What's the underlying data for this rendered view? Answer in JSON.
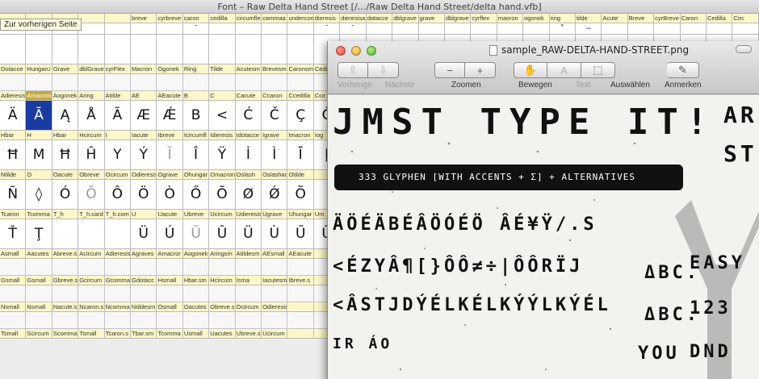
{
  "font_window": {
    "title": "Font – Raw Delta Hand Street [/…/Raw Delta Hand Street/delta hand.vfb]",
    "tooltip": "Zur vorherigen Seite",
    "rows": [
      {
        "kind": "name",
        "cells": [
          "",
          "",
          "",
          "",
          "",
          "breve",
          "cyrbreve",
          "caron",
          "cedilla",
          "circumfle",
          "commaa",
          "undercom",
          "dieresis",
          "dieresisa",
          "dotacce",
          "dblgrave",
          "grave",
          "dblgrave",
          "cyrflex",
          "macron",
          "ogonek",
          "ring",
          "tilde",
          "Acute",
          "Breve",
          "cyrBreve",
          "Caron",
          "Cedilla",
          "Circ"
        ]
      },
      {
        "kind": "glyph-short",
        "cells": [
          "",
          "",
          "",
          "",
          "",
          "",
          "",
          "˘",
          "",
          "",
          "",
          "",
          "¨",
          "¨",
          "",
          "",
          "",
          "",
          "",
          "",
          "",
          "˚",
          "~",
          "",
          "",
          "",
          "",
          "",
          ""
        ]
      },
      {
        "kind": "glyph-tall",
        "cells": [
          "",
          "",
          "",
          "",
          "",
          "",
          "",
          "",
          "",
          "",
          "",
          "",
          "",
          "",
          "",
          "",
          "",
          "",
          "",
          "",
          "",
          "",
          "",
          "",
          "",
          "",
          "",
          "",
          ""
        ]
      },
      {
        "kind": "name",
        "cells": [
          "Dotacce",
          "Hungaru",
          "Grave",
          "dblGrave",
          "cyrFlex",
          "Macron",
          "Ogonek",
          "Ring",
          "Tilde",
          "Acutesm",
          "Brevesm",
          "Caronsm",
          "Cedillas",
          "",
          "",
          "",
          "",
          "",
          "",
          "",
          "",
          "",
          "",
          "",
          "",
          "",
          "",
          "",
          ""
        ]
      },
      {
        "kind": "spacer",
        "cells": [
          "",
          "",
          "",
          "",
          "",
          "",
          "",
          "",
          "",
          "",
          "",
          "",
          "",
          "",
          "",
          "",
          "",
          "",
          "",
          "",
          "",
          "",
          "",
          "",
          "",
          "",
          "",
          "",
          ""
        ]
      },
      {
        "kind": "name",
        "cells": [
          "Adieresis",
          "Amacron",
          "Aogonek",
          "Aring",
          "Atilde",
          "AE",
          "AEacute",
          "B",
          "C",
          "Cacute",
          "Ccaron",
          "Ccedilla",
          "Ccir",
          "",
          "",
          "",
          "",
          "",
          "",
          "",
          "",
          "",
          "",
          "",
          "",
          "",
          "",
          "",
          ""
        ]
      },
      {
        "kind": "glyph-tall",
        "cells": [
          "Ä",
          "Ā",
          "Ą",
          "Å",
          "Ã",
          "Æ",
          "Ǽ",
          "B",
          "<",
          "Ć",
          "Č",
          "Ç",
          "Ĉ",
          "",
          "",
          "",
          "",
          "",
          "",
          "",
          "",
          "",
          "",
          "",
          "",
          "",
          "",
          "",
          ""
        ]
      },
      {
        "kind": "name",
        "cells": [
          "Hbar",
          "H",
          "Hbar",
          "Hcircum",
          "I",
          "Iacute",
          "Ibreve",
          "Icircumfl",
          "Idieresis",
          "Idotacce",
          "Igrave",
          "Imacron",
          "Iog",
          "",
          "",
          "",
          "",
          "",
          "",
          "",
          "",
          "",
          "",
          "",
          "",
          "",
          "",
          "",
          ""
        ]
      },
      {
        "kind": "glyph-tall",
        "cells": [
          "Ħ",
          "M",
          "Ħ",
          "Ĥ",
          "Y",
          "Ý",
          "Ĭ",
          "Î",
          "Ÿ",
          "İ",
          "Ì",
          "Ī",
          "Į",
          "",
          "",
          "",
          "",
          "",
          "",
          "",
          "",
          "",
          "",
          "",
          "",
          "",
          "",
          "",
          ""
        ]
      },
      {
        "kind": "name",
        "cells": [
          "Ntilde",
          "O",
          "Oacute",
          "Obreve",
          "Ocircum",
          "Odieresis",
          "Ograve",
          "Ohungar",
          "Omacron",
          "Oslash",
          "Oslashac",
          "Otilde",
          "",
          "",
          "",
          "",
          "",
          "",
          "",
          "",
          "",
          "",
          "",
          "",
          "",
          "",
          "",
          "",
          ""
        ]
      },
      {
        "kind": "glyph-tall",
        "cells": [
          "Ñ",
          "◊",
          "Ó",
          "Ŏ",
          "Ô",
          "Ö",
          "Ò",
          "Ő",
          "Ō",
          "Ø",
          "Ǿ",
          "Õ",
          "",
          "",
          "",
          "",
          "",
          "",
          "",
          "",
          "",
          "",
          "",
          "",
          "",
          "",
          "",
          "",
          ""
        ]
      },
      {
        "kind": "name",
        "cells": [
          "Tcaron",
          "Tcomma",
          "T_h",
          "T_h.card",
          "T_h.com",
          "U",
          "Uacute",
          "Ubreve",
          "Ucircum",
          "Udieresis",
          "Ugrave",
          "Uhungar",
          "Um",
          "",
          "",
          "",
          "",
          "",
          "",
          "",
          "",
          "",
          "",
          "",
          "",
          "",
          "",
          "",
          ""
        ]
      },
      {
        "kind": "glyph-tall",
        "cells": [
          "Ť",
          "Ţ",
          "",
          "",
          "",
          "Ü",
          "Ú",
          "Ŭ",
          "Û",
          "Ü",
          "Ù",
          "Ű",
          "Ū",
          "",
          "",
          "",
          "",
          "",
          "",
          "",
          "",
          "",
          "",
          "",
          "",
          "",
          "",
          "",
          ""
        ]
      },
      {
        "kind": "name",
        "cells": [
          "Asmall",
          "Aacutes",
          "Abreve.s",
          "Acircum",
          "Adieresis",
          "Agraves",
          "Amacror",
          "Aogonek",
          "Aringsm",
          "Atildesm",
          "AEsmall",
          "AEacute",
          "",
          "",
          "",
          "",
          "",
          "",
          "",
          "",
          "",
          "",
          "",
          "",
          "",
          "",
          "",
          "",
          ""
        ]
      },
      {
        "kind": "spacer",
        "cells": [
          "",
          "",
          "",
          "",
          "",
          "",
          "",
          "",
          "",
          "",
          "",
          "",
          "",
          "",
          "",
          "",
          "",
          "",
          "",
          "",
          "",
          "",
          "",
          "",
          "",
          "",
          "",
          "",
          ""
        ]
      },
      {
        "kind": "name",
        "cells": [
          "Gsmall",
          "Gsmall",
          "Gbreve.s",
          "Gcircum",
          "Gcomma",
          "Gdotacc",
          "Hsmall",
          "Hbar.sm",
          "Hcircum",
          "Isma",
          "Iacutesm",
          "Ibreve.s",
          "",
          "",
          "",
          "",
          "",
          "",
          "",
          "",
          "",
          "",
          "",
          "",
          "",
          "",
          "",
          "",
          ""
        ]
      },
      {
        "kind": "spacer",
        "cells": [
          "",
          "",
          "",
          "",
          "",
          "",
          "",
          "",
          "",
          "",
          "",
          "",
          "",
          "",
          "",
          "",
          "",
          "",
          "",
          "",
          "",
          "",
          "",
          "",
          "",
          "",
          "",
          "",
          ""
        ]
      },
      {
        "kind": "name",
        "cells": [
          "Nsmall",
          "Nsmall",
          "Nacute.s",
          "Ncaron.s",
          "Ncomma",
          "Ntildesm",
          "Osmall",
          "Oacutes",
          "Obreve.s",
          "Ocircum",
          "Odieresis",
          "",
          "",
          "",
          "",
          "",
          "",
          "",
          "",
          "",
          "",
          "",
          "",
          "",
          "",
          "",
          "",
          "",
          ""
        ]
      },
      {
        "kind": "spacer",
        "cells": [
          "",
          "",
          "",
          "",
          "",
          "",
          "",
          "",
          "",
          "",
          "",
          "",
          "",
          "",
          "",
          "",
          "",
          "",
          "",
          "",
          "",
          "",
          "",
          "",
          "",
          "",
          "",
          "",
          ""
        ]
      },
      {
        "kind": "name",
        "cells": [
          "Tsmall",
          "Scircum",
          "Scomma",
          "Tsmall",
          "Tcaron.s",
          "Tbar.sm",
          "Tcomma",
          "Usmall",
          "Uacutes",
          "Ubreve.s",
          "Ucircum",
          "",
          "",
          "",
          "",
          "",
          "",
          "",
          "",
          "",
          "",
          "",
          "",
          "",
          "",
          "",
          "",
          "",
          ""
        ]
      }
    ],
    "selected_index": 1
  },
  "preview_window": {
    "title": "sample_RAW-DELTA-HAND-STREET.png",
    "toolbar": {
      "back_label": "Vorherige",
      "next_label": "Nächste",
      "zoom_label": "Zoomen",
      "move_label": "Bewegen",
      "text_label": "Text",
      "select_label": "Auswählen",
      "annotate_label": "Anmerken",
      "zoom_out_glyph": "−",
      "zoom_in_glyph": "+",
      "back_glyph": "⇧",
      "next_glyph": "⇩",
      "move_glyph": "✋",
      "text_glyph": "A",
      "select_glyph": "⬚",
      "annotate_glyph": "✎"
    },
    "specimen": {
      "headline": "JMST TYPE IT!",
      "banner": "333 GLYPHEN [WITH ACCENTS + Σ] + ALTERNATIVES",
      "row1": "ÄÖÉÄBÉÂÖÓÉÖ ÂÉ¥Ÿ/.S",
      "row2": "<ÉZYÂ¶[}ÔÔ≠÷|ÔÔRÏJ",
      "row3": "<ÂSTJDÝÉLKÉLKÝÝLKÝÉL",
      "row4": "IR ÁO",
      "side1": "ΔBC.",
      "side2": "ΔBC.",
      "side3": "YOU",
      "right_top": "AR",
      "right_mid": "ST",
      "right_a": "EASY",
      "right_b": "123",
      "right_c": "DND"
    }
  }
}
